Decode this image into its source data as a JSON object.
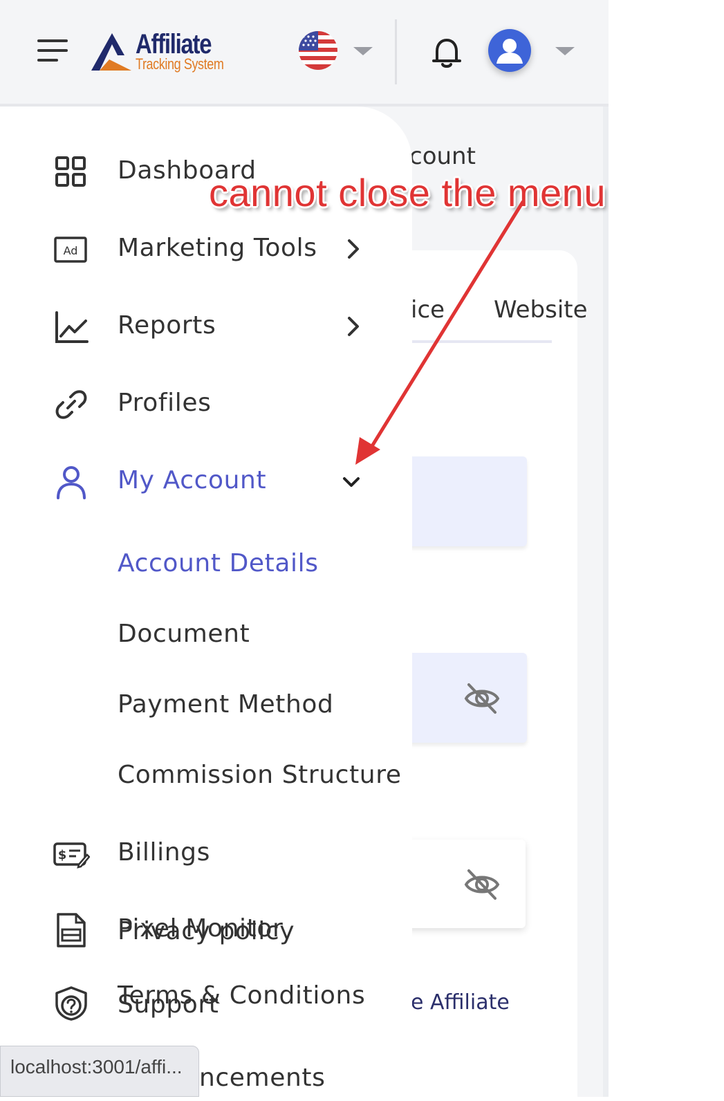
{
  "header": {
    "logo_title": "Affiliate",
    "logo_subtitle": "Tracking System"
  },
  "background_page": {
    "heading_fragment": "count",
    "tab_fragment": "ice",
    "tab_website": "Website",
    "bottom_fragment": "e Affiliate"
  },
  "sidebar": {
    "items": [
      {
        "label": "Dashboard",
        "icon": "dashboard-grid-icon"
      },
      {
        "label": "Marketing Tools",
        "icon": "ad-icon"
      },
      {
        "label": "Reports",
        "icon": "line-chart-icon"
      },
      {
        "label": "Profiles",
        "icon": "link-icon"
      },
      {
        "label": "My Account",
        "icon": "user-icon"
      }
    ],
    "sub_items": [
      "Account Details",
      "Document",
      "Payment Method",
      "Commission Structure"
    ],
    "billings": "Billings",
    "overlap_a": {
      "label_1": "Pixel Monitor",
      "label_2": "Privacy policy"
    },
    "overlap_b": {
      "label_1": "Terms & Conditions",
      "label_2": "Support"
    },
    "cutoff": "ncements"
  },
  "annotation": {
    "text": "cannot close the menu",
    "color": "#e03434"
  },
  "statusbar": {
    "url": "localhost:3001/affi..."
  },
  "colors": {
    "accent": "#5158c8",
    "brand_navy": "#202a6b",
    "brand_orange": "#e07b24"
  }
}
